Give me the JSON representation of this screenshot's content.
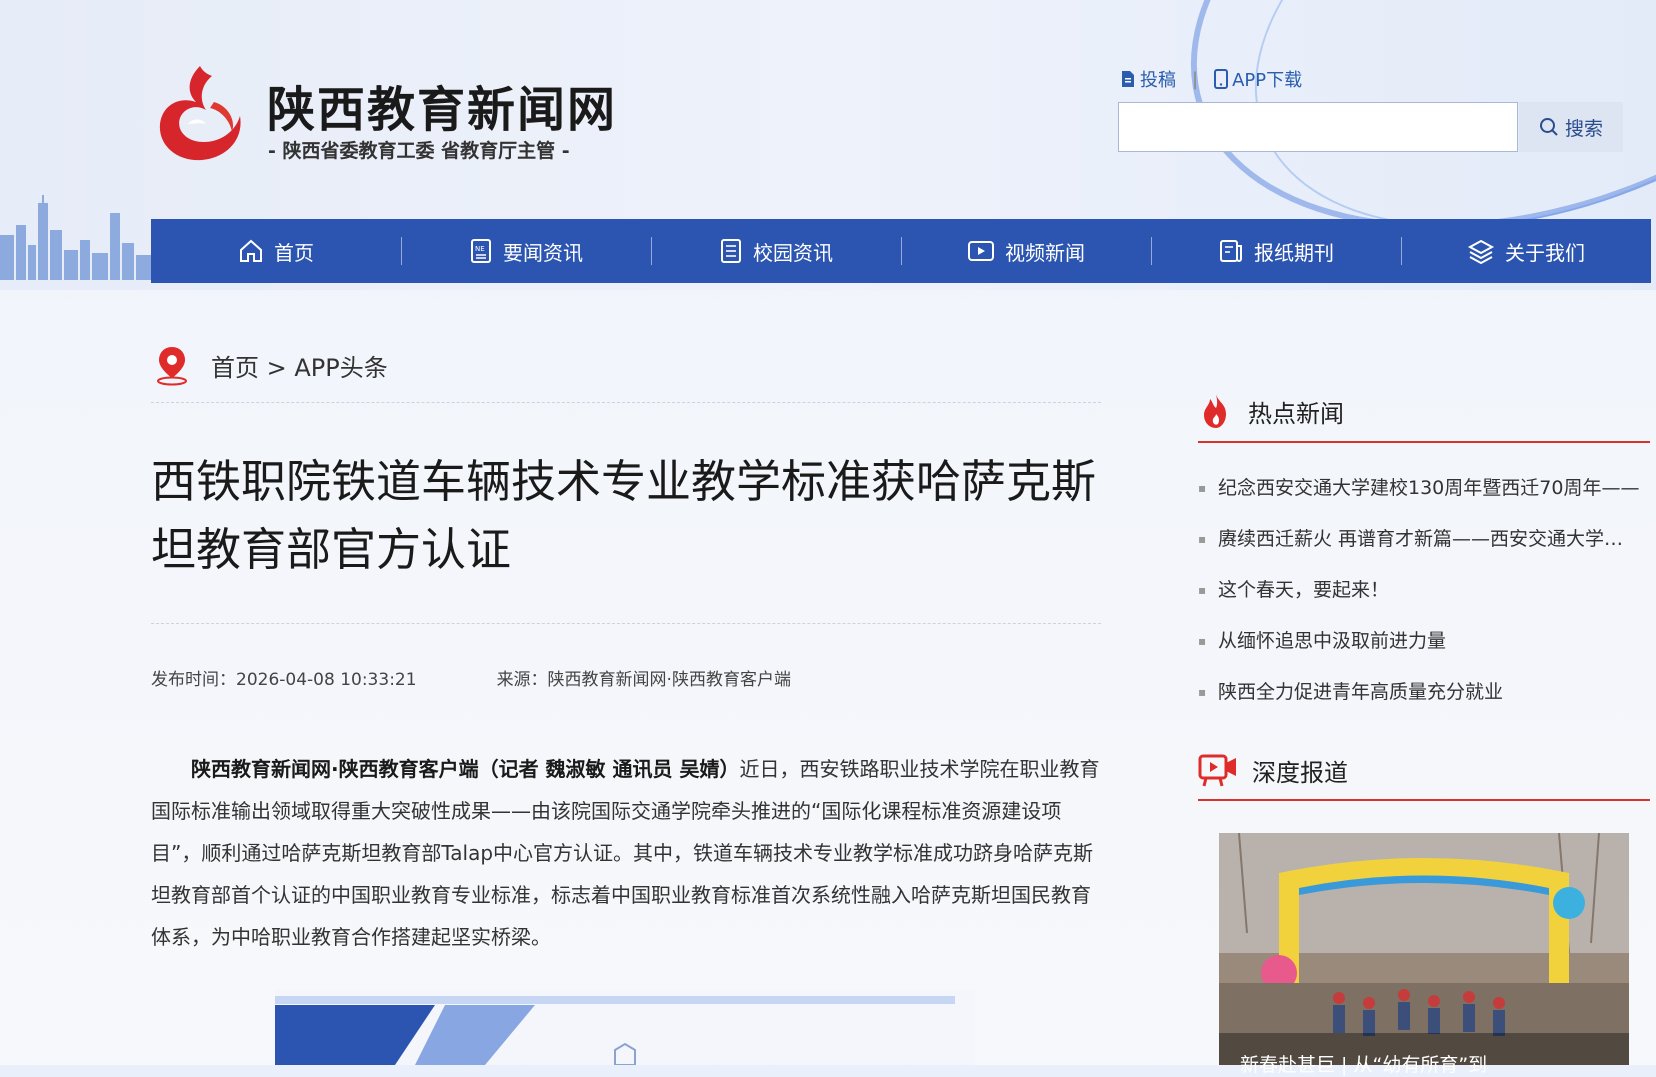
{
  "header": {
    "site_name": "陕西教育新闻网",
    "site_subtitle": "- 陕西省委教育工委  省教育厅主管 -",
    "top_links": [
      {
        "label": "投稿",
        "icon": "document-icon"
      },
      {
        "label": "APP下载",
        "icon": "phone-icon"
      }
    ],
    "search": {
      "value": "",
      "placeholder": "",
      "button_label": "搜索"
    }
  },
  "nav": {
    "items": [
      {
        "label": "首页",
        "icon": "home-icon"
      },
      {
        "label": "要闻资讯",
        "icon": "news-icon"
      },
      {
        "label": "校园资讯",
        "icon": "list-icon"
      },
      {
        "label": "视频新闻",
        "icon": "video-icon"
      },
      {
        "label": "报纸期刊",
        "icon": "newspaper-icon"
      },
      {
        "label": "关于我们",
        "icon": "layers-icon"
      }
    ]
  },
  "breadcrumb": {
    "text": "首页 > APP头条"
  },
  "article": {
    "title": "西铁职院铁道车辆技术专业教学标准获哈萨克斯坦教育部官方认证",
    "publish_time": "发布时间：2026-04-08 10:33:21",
    "source": "来源：陕西教育新闻网·陕西教育客户端",
    "lead_bold": "陕西教育新闻网·陕西教育客户端（记者 魏淑敏 通讯员 吴婧）",
    "lead_text": "近日，西安铁路职业技术学院在职业教育国际标准输出领域取得重大突破性成果——由该院国际交通学院牵头推进的“国际化课程标准资源建设项目”，顺利通过哈萨克斯坦教育部Talap中心官方认证。其中，铁道车辆技术专业教学标准成功跻身哈萨克斯坦教育部首个认证的中国职业教育专业标准，标志着中国职业教育标准首次系统性融入哈萨克斯坦国民教育体系，为中哈职业教育合作搭建起坚实桥梁。"
  },
  "sidebar": {
    "hot_title": "热点新闻",
    "hot_items": [
      "纪念西安交通大学建校130周年暨西迁70周年——",
      "赓续西迁薪火 再谱育才新篇——西安交通大学…",
      "这个春天，要起来！",
      "从缅怀追思中汲取前进力量",
      "陕西全力促进青年高质量充分就业"
    ],
    "deep_title": "深度报道",
    "deep_caption": "新春赴甚巨 | 从“幼有所育”到"
  },
  "colors": {
    "nav_bg": "#2c55b1",
    "accent_red": "#d9322b",
    "link_blue": "#2a5db0"
  }
}
